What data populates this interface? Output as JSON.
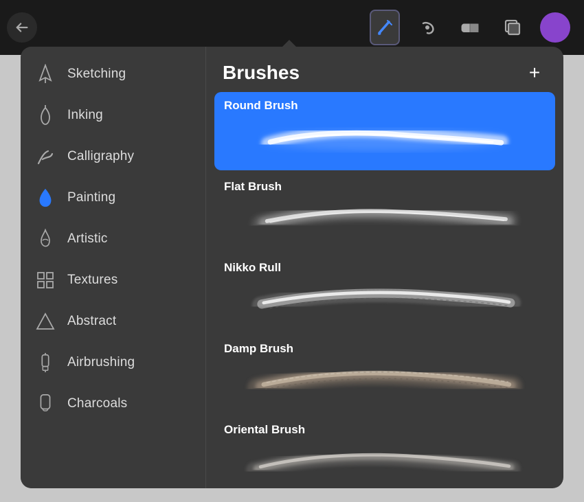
{
  "toolbar": {
    "tools": [
      {
        "name": "brush",
        "label": "Brush",
        "active": true
      },
      {
        "name": "smudge",
        "label": "Smudge",
        "active": false
      },
      {
        "name": "eraser",
        "label": "Eraser",
        "active": false
      },
      {
        "name": "layers",
        "label": "Layers",
        "active": false
      }
    ],
    "avatar_color": "#8844cc"
  },
  "panel": {
    "title": "Brushes",
    "add_label": "+"
  },
  "sidebar": {
    "items": [
      {
        "id": "sketching",
        "label": "Sketching",
        "icon": "pencil-tip"
      },
      {
        "id": "inking",
        "label": "Inking",
        "icon": "ink-drop"
      },
      {
        "id": "calligraphy",
        "label": "Calligraphy",
        "icon": "calligraphy"
      },
      {
        "id": "painting",
        "label": "Painting",
        "icon": "drop"
      },
      {
        "id": "artistic",
        "label": "Artistic",
        "icon": "flame"
      },
      {
        "id": "textures",
        "label": "Textures",
        "icon": "grid"
      },
      {
        "id": "abstract",
        "label": "Abstract",
        "icon": "triangle"
      },
      {
        "id": "airbrushing",
        "label": "Airbrushing",
        "icon": "airbrush"
      },
      {
        "id": "charcoals",
        "label": "Charcoals",
        "icon": "charcoal"
      }
    ]
  },
  "brushes": {
    "items": [
      {
        "id": "round-brush",
        "label": "Round Brush",
        "selected": true
      },
      {
        "id": "flat-brush",
        "label": "Flat Brush",
        "selected": false
      },
      {
        "id": "nikko-rull",
        "label": "Nikko Rull",
        "selected": false
      },
      {
        "id": "damp-brush",
        "label": "Damp Brush",
        "selected": false
      },
      {
        "id": "oriental-brush",
        "label": "Oriental Brush",
        "selected": false
      }
    ]
  }
}
